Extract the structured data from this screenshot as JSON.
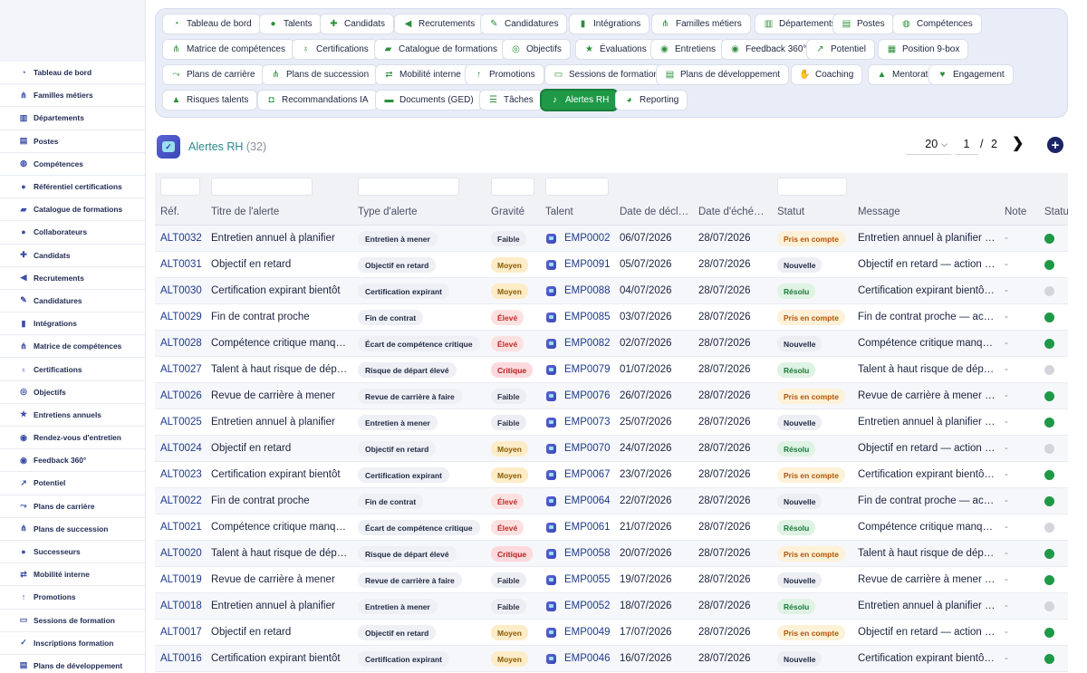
{
  "sidebar": {
    "items": [
      {
        "label": "Tableau de bord",
        "icon": "dashboard-icon"
      },
      {
        "label": "Familles métiers",
        "icon": "hierarchy-icon"
      },
      {
        "label": "Départements",
        "icon": "building-icon"
      },
      {
        "label": "Postes",
        "icon": "badge-icon"
      },
      {
        "label": "Compétences",
        "icon": "brain-icon"
      },
      {
        "label": "Référentiel certifications",
        "icon": "certificate-icon"
      },
      {
        "label": "Catalogue de formations",
        "icon": "graduation-icon"
      },
      {
        "label": "Collaborateurs",
        "icon": "user-icon"
      },
      {
        "label": "Candidats",
        "icon": "user-plus-icon"
      },
      {
        "label": "Recrutements",
        "icon": "megaphone-icon"
      },
      {
        "label": "Candidatures",
        "icon": "file-signature-icon"
      },
      {
        "label": "Intégrations",
        "icon": "door-icon"
      },
      {
        "label": "Matrice de compétences",
        "icon": "network-icon"
      },
      {
        "label": "Certifications",
        "icon": "ribbon-icon"
      },
      {
        "label": "Objectifs",
        "icon": "target-icon"
      },
      {
        "label": "Entretiens annuels",
        "icon": "star-icon"
      },
      {
        "label": "Rendez-vous d'entretien",
        "icon": "chat-icon"
      },
      {
        "label": "Feedback 360°",
        "icon": "comment-icon"
      },
      {
        "label": "Potentiel",
        "icon": "chart-line-icon"
      },
      {
        "label": "Plans de carrière",
        "icon": "route-icon"
      },
      {
        "label": "Plans de succession",
        "icon": "hierarchy-icon"
      },
      {
        "label": "Successeurs",
        "icon": "users-icon"
      },
      {
        "label": "Mobilité interne",
        "icon": "arrows-icon"
      },
      {
        "label": "Promotions",
        "icon": "arrow-up-icon"
      },
      {
        "label": "Sessions de formation",
        "icon": "chalkboard-icon"
      },
      {
        "label": "Inscriptions formation",
        "icon": "user-check-icon"
      },
      {
        "label": "Plans de développement",
        "icon": "clipboard-icon"
      }
    ]
  },
  "modules": [
    {
      "label": "Tableau de bord",
      "icon": "dashboard-icon"
    },
    {
      "label": "Talents",
      "icon": "user-icon"
    },
    {
      "label": "Candidats",
      "icon": "user-plus-icon"
    },
    {
      "label": "Recrutements",
      "icon": "megaphone-icon"
    },
    {
      "label": "Candidatures",
      "icon": "file-signature-icon"
    },
    {
      "label": "Intégrations",
      "icon": "door-icon"
    },
    {
      "label": "Familles métiers",
      "icon": "hierarchy-icon"
    },
    {
      "label": "Départements",
      "icon": "building-icon"
    },
    {
      "label": "Postes",
      "icon": "badge-icon"
    },
    {
      "label": "Compétences",
      "icon": "brain-icon"
    },
    {
      "label": "Matrice de compétences",
      "icon": "network-icon"
    },
    {
      "label": "Certifications",
      "icon": "ribbon-icon"
    },
    {
      "label": "Catalogue de formations",
      "icon": "graduation-icon"
    },
    {
      "label": "Objectifs",
      "icon": "target-icon"
    },
    {
      "label": "Évaluations",
      "icon": "star-icon"
    },
    {
      "label": "Entretiens",
      "icon": "chat-icon"
    },
    {
      "label": "Feedback 360°",
      "icon": "comment-icon"
    },
    {
      "label": "Potentiel",
      "icon": "chart-line-icon"
    },
    {
      "label": "Position 9-box",
      "icon": "grid-icon"
    },
    {
      "label": "Plans de carrière",
      "icon": "route-icon"
    },
    {
      "label": "Plans de succession",
      "icon": "hierarchy-icon"
    },
    {
      "label": "Mobilité interne",
      "icon": "arrows-icon"
    },
    {
      "label": "Promotions",
      "icon": "arrow-up-icon"
    },
    {
      "label": "Sessions de formation",
      "icon": "chalkboard-icon"
    },
    {
      "label": "Plans de développement",
      "icon": "clipboard-icon"
    },
    {
      "label": "Coaching",
      "icon": "handshake-icon"
    },
    {
      "label": "Mentorat",
      "icon": "mentor-icon"
    },
    {
      "label": "Engagement",
      "icon": "heart-icon"
    },
    {
      "label": "Risques talents",
      "icon": "warning-icon"
    },
    {
      "label": "Recommandations IA",
      "icon": "robot-icon"
    },
    {
      "label": "Documents (GED)",
      "icon": "folder-icon"
    },
    {
      "label": "Tâches",
      "icon": "tasks-icon"
    },
    {
      "label": "Alertes RH",
      "icon": "bell-icon",
      "active": true
    },
    {
      "label": "Reporting",
      "icon": "pie-chart-icon"
    }
  ],
  "page": {
    "title": "Alertes RH",
    "count": "(32)",
    "page_size": "20",
    "current_page": "1",
    "page_separator": "/",
    "total_pages": "2"
  },
  "table": {
    "columns": [
      "Réf.",
      "Titre de l'alerte",
      "Type d'alerte",
      "Gravité",
      "Talent",
      "Date de décl…",
      "Date d'éché…",
      "Statut",
      "Message",
      "Note",
      "Statut"
    ],
    "rows": [
      {
        "ref": "ALT0032",
        "titre": "Entretien annuel à planifier",
        "type": "Entretien à mener",
        "gravite": "Faible",
        "talent": "EMP0002",
        "d1": "06/07/2026",
        "d2": "28/07/2026",
        "statut": "Pris en compte",
        "message": "Entretien annuel à planifier …",
        "note": "-",
        "actif": true
      },
      {
        "ref": "ALT0031",
        "titre": "Objectif en retard",
        "type": "Objectif en retard",
        "gravite": "Moyen",
        "talent": "EMP0091",
        "d1": "05/07/2026",
        "d2": "28/07/2026",
        "statut": "Nouvelle",
        "message": "Objectif en retard — action …",
        "note": "-",
        "actif": true
      },
      {
        "ref": "ALT0030",
        "titre": "Certification expirant bientôt",
        "type": "Certification expirant",
        "gravite": "Moyen",
        "talent": "EMP0088",
        "d1": "04/07/2026",
        "d2": "28/07/2026",
        "statut": "Résolu",
        "message": "Certification expirant bientôt…",
        "note": "-",
        "actif": false
      },
      {
        "ref": "ALT0029",
        "titre": "Fin de contrat proche",
        "type": "Fin de contrat",
        "gravite": "Élevé",
        "talent": "EMP0085",
        "d1": "03/07/2026",
        "d2": "28/07/2026",
        "statut": "Pris en compte",
        "message": "Fin de contrat proche — acti…",
        "note": "-",
        "actif": true
      },
      {
        "ref": "ALT0028",
        "titre": "Compétence critique manqu…",
        "type": "Écart de compétence critique",
        "gravite": "Élevé",
        "talent": "EMP0082",
        "d1": "02/07/2026",
        "d2": "28/07/2026",
        "statut": "Nouvelle",
        "message": "Compétence critique manqu…",
        "note": "-",
        "actif": true
      },
      {
        "ref": "ALT0027",
        "titre": "Talent à haut risque de départ",
        "type": "Risque de départ élevé",
        "gravite": "Critique",
        "talent": "EMP0079",
        "d1": "01/07/2026",
        "d2": "28/07/2026",
        "statut": "Résolu",
        "message": "Talent à haut risque de dép…",
        "note": "-",
        "actif": false
      },
      {
        "ref": "ALT0026",
        "titre": "Revue de carrière à mener",
        "type": "Revue de carrière à faire",
        "gravite": "Faible",
        "talent": "EMP0076",
        "d1": "26/07/2026",
        "d2": "28/07/2026",
        "statut": "Pris en compte",
        "message": "Revue de carrière à mener …",
        "note": "-",
        "actif": true
      },
      {
        "ref": "ALT0025",
        "titre": "Entretien annuel à planifier",
        "type": "Entretien à mener",
        "gravite": "Faible",
        "talent": "EMP0073",
        "d1": "25/07/2026",
        "d2": "28/07/2026",
        "statut": "Nouvelle",
        "message": "Entretien annuel à planifier …",
        "note": "-",
        "actif": true
      },
      {
        "ref": "ALT0024",
        "titre": "Objectif en retard",
        "type": "Objectif en retard",
        "gravite": "Moyen",
        "talent": "EMP0070",
        "d1": "24/07/2026",
        "d2": "28/07/2026",
        "statut": "Résolu",
        "message": "Objectif en retard — action …",
        "note": "-",
        "actif": false
      },
      {
        "ref": "ALT0023",
        "titre": "Certification expirant bientôt",
        "type": "Certification expirant",
        "gravite": "Moyen",
        "talent": "EMP0067",
        "d1": "23/07/2026",
        "d2": "28/07/2026",
        "statut": "Pris en compte",
        "message": "Certification expirant bientôt…",
        "note": "-",
        "actif": true
      },
      {
        "ref": "ALT0022",
        "titre": "Fin de contrat proche",
        "type": "Fin de contrat",
        "gravite": "Élevé",
        "talent": "EMP0064",
        "d1": "22/07/2026",
        "d2": "28/07/2026",
        "statut": "Nouvelle",
        "message": "Fin de contrat proche — acti…",
        "note": "-",
        "actif": true
      },
      {
        "ref": "ALT0021",
        "titre": "Compétence critique manqu…",
        "type": "Écart de compétence critique",
        "gravite": "Élevé",
        "talent": "EMP0061",
        "d1": "21/07/2026",
        "d2": "28/07/2026",
        "statut": "Résolu",
        "message": "Compétence critique manqu…",
        "note": "-",
        "actif": false
      },
      {
        "ref": "ALT0020",
        "titre": "Talent à haut risque de départ",
        "type": "Risque de départ élevé",
        "gravite": "Critique",
        "talent": "EMP0058",
        "d1": "20/07/2026",
        "d2": "28/07/2026",
        "statut": "Pris en compte",
        "message": "Talent à haut risque de dép…",
        "note": "-",
        "actif": true
      },
      {
        "ref": "ALT0019",
        "titre": "Revue de carrière à mener",
        "type": "Revue de carrière à faire",
        "gravite": "Faible",
        "talent": "EMP0055",
        "d1": "19/07/2026",
        "d2": "28/07/2026",
        "statut": "Nouvelle",
        "message": "Revue de carrière à mener …",
        "note": "-",
        "actif": true
      },
      {
        "ref": "ALT0018",
        "titre": "Entretien annuel à planifier",
        "type": "Entretien à mener",
        "gravite": "Faible",
        "talent": "EMP0052",
        "d1": "18/07/2026",
        "d2": "28/07/2026",
        "statut": "Résolu",
        "message": "Entretien annuel à planifier …",
        "note": "-",
        "actif": false
      },
      {
        "ref": "ALT0017",
        "titre": "Objectif en retard",
        "type": "Objectif en retard",
        "gravite": "Moyen",
        "talent": "EMP0049",
        "d1": "17/07/2026",
        "d2": "28/07/2026",
        "statut": "Pris en compte",
        "message": "Objectif en retard — action …",
        "note": "-",
        "actif": true
      },
      {
        "ref": "ALT0016",
        "titre": "Certification expirant bientôt",
        "type": "Certification expirant",
        "gravite": "Moyen",
        "talent": "EMP0046",
        "d1": "16/07/2026",
        "d2": "28/07/2026",
        "statut": "Nouvelle",
        "message": "Certification expirant bientôt…",
        "note": "-",
        "actif": true
      }
    ]
  },
  "colors": {
    "accent": "#1f9947",
    "title": "#2a8a8a",
    "link": "#1e3a8a",
    "faible_bg": "#eceef3",
    "faible_fg": "#2b3247",
    "moyen_bg": "#fdecc8",
    "moyen_fg": "#8a5a00",
    "eleve_bg": "#fde1e1",
    "eleve_fg": "#c62828",
    "critique_bg": "#fcd9dc",
    "critique_fg": "#b71c1c",
    "pris_bg": "#fdf1d8",
    "pris_fg": "#b45309",
    "nouvelle_bg": "#eceef3",
    "nouvelle_fg": "#1f2842",
    "resolu_bg": "#dff3e4",
    "resolu_fg": "#1b7a3a",
    "dot_active": "#1f9947",
    "dot_inactive": "#d3d5da"
  }
}
